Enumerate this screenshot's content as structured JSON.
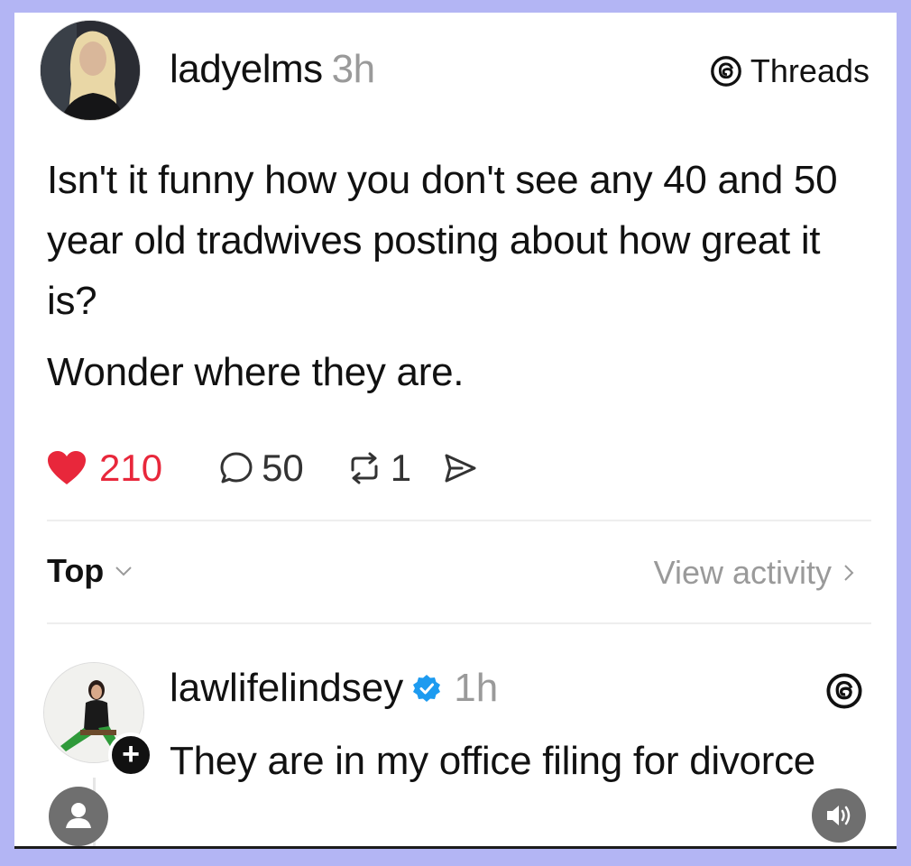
{
  "post": {
    "username": "ladyelms",
    "time": "3h",
    "brand": "Threads",
    "text_lines": [
      "Isn't it funny how you don't see any 40 and 50 year old tradwives posting about how great it is?",
      "Wonder where they are."
    ],
    "likes": "210",
    "replies": "50",
    "reposts": "1",
    "like_color": "#e8273b"
  },
  "sort": {
    "label": "Top",
    "view_activity": "View activity"
  },
  "reply": {
    "username": "lawlifelindsey",
    "time": "1h",
    "verified": true,
    "text": "They are in my office filing for divorce"
  },
  "icons": {
    "brand": "threads-icon",
    "like": "heart-icon",
    "reply": "comment-icon",
    "repost": "repost-icon",
    "share": "share-icon",
    "verified": "verified-badge-icon",
    "follow": "plus-icon",
    "profile": "person-icon",
    "audio": "speaker-icon"
  }
}
